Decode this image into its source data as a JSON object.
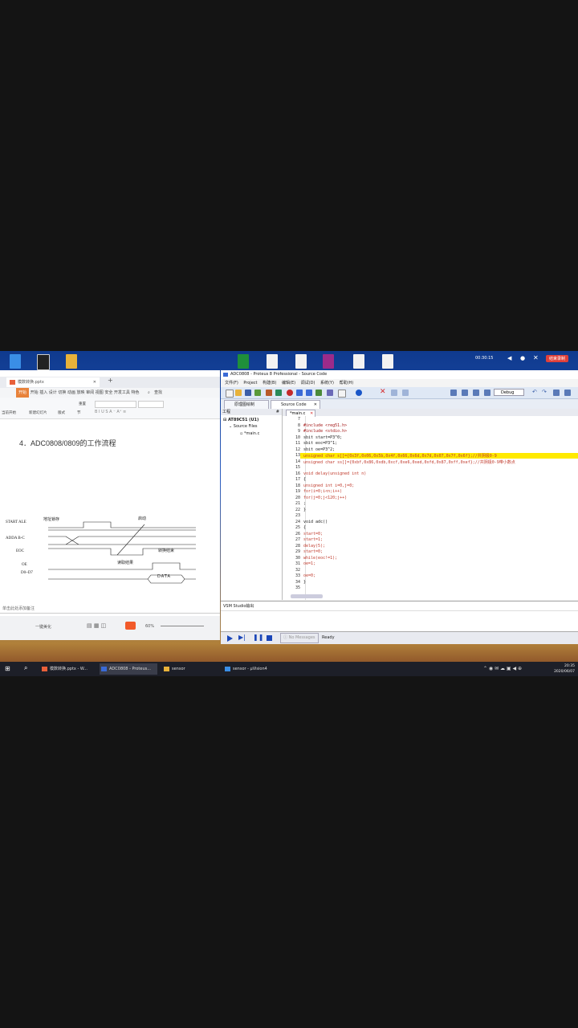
{
  "recorder": {
    "time": "00:30:15",
    "end_label": "结束录制"
  },
  "ppt": {
    "tab_title": "模数转换.pptx",
    "menu": "开始  插入  设计  切换  动画  放映  审阅  视图  安全  开发工具  特色",
    "search_label": "查找",
    "ribbon_labels": [
      "当前开始",
      "新建幻灯片",
      "版式",
      "节",
      "重置"
    ],
    "slide_title": "4．ADC0808/0809的工作流程",
    "signals": [
      "START ALE",
      "ADDA B-C",
      "EOC",
      "OE",
      "D0~D7"
    ],
    "annotations": {
      "addr_lock": "地址锁存",
      "start": "启动",
      "convert_done": "转换结束",
      "read_result": "读取结果",
      "data": "DATA"
    },
    "notes_placeholder": "单击此处添加备注",
    "zoom": "60%",
    "status_left": "一键美化"
  },
  "proteus": {
    "window_title": "ADC0808 - Proteus 8 Professional - Source Code",
    "menu": [
      "文件(F)",
      "Project",
      "构建(B)",
      "编辑(E)",
      "调试(D)",
      "系统(Y)",
      "帮助(H)"
    ],
    "debug_dropdown": "Debug",
    "tabs": [
      "原理图绘制",
      "Source Code"
    ],
    "project_header": "工程",
    "tree": [
      "AT89C51 (U1)",
      "Source Files",
      "*main.c"
    ],
    "editor_tab": "*main.c",
    "code": [
      {
        "n": "7",
        "t": ""
      },
      {
        "n": "8",
        "t": "#include <reg51.h>"
      },
      {
        "n": "9",
        "t": "#include <stdio.h>"
      },
      {
        "n": "10",
        "t": "sbit start=P3^0;"
      },
      {
        "n": "11",
        "t": "sbit eoc=P3^1;"
      },
      {
        "n": "12",
        "t": "sbit oe=P3^2;"
      },
      {
        "n": "13",
        "t": "unsigned char s[]={0x3f,0x06,0x5b,0x4f,0x66,0x6d,0x7d,0x07,0x7f,0x6f};//共阴极0-9"
      },
      {
        "n": "14",
        "t": "unsigned char ss[]={0xbf,0x86,0xdb,0xcf,0xe6,0xed,0xfd,0x87,0xff,0xef};//共阴极0-9带小数点"
      },
      {
        "n": "15",
        "t": ""
      },
      {
        "n": "16",
        "t": "void delay(unsigned int n)"
      },
      {
        "n": "17",
        "t": "{"
      },
      {
        "n": "18",
        "t": "    unsigned int i=0,j=0;"
      },
      {
        "n": "19",
        "t": "    for(i=0;i<n;i++)"
      },
      {
        "n": "20",
        "t": "        for(j=0;j<120;j++)"
      },
      {
        "n": "21",
        "t": "            ;"
      },
      {
        "n": "22",
        "t": "}"
      },
      {
        "n": "23",
        "t": ""
      },
      {
        "n": "24",
        "t": "void adc()"
      },
      {
        "n": "25",
        "t": "{"
      },
      {
        "n": "26",
        "t": "    start=0;"
      },
      {
        "n": "27",
        "t": "    start=1;"
      },
      {
        "n": "28",
        "t": "    delay(5);"
      },
      {
        "n": "29",
        "t": "    start=0;"
      },
      {
        "n": "30",
        "t": "    while(eoc!=1);"
      },
      {
        "n": "31",
        "t": "    oe=1;"
      },
      {
        "n": "32",
        "t": ""
      },
      {
        "n": "33",
        "t": "    oe=0;"
      },
      {
        "n": "34",
        "t": "}"
      },
      {
        "n": "35",
        "t": ""
      }
    ],
    "output_header": "VSM Studio输出",
    "sim_status": "No Messages",
    "ready": "Ready"
  },
  "taskbar": {
    "items": [
      "模数转换.pptx - W...",
      "ADC0808 - Proteus...",
      "sensor",
      "sensor - μVision4"
    ],
    "time": "20:35",
    "date": "2020/06/07"
  }
}
